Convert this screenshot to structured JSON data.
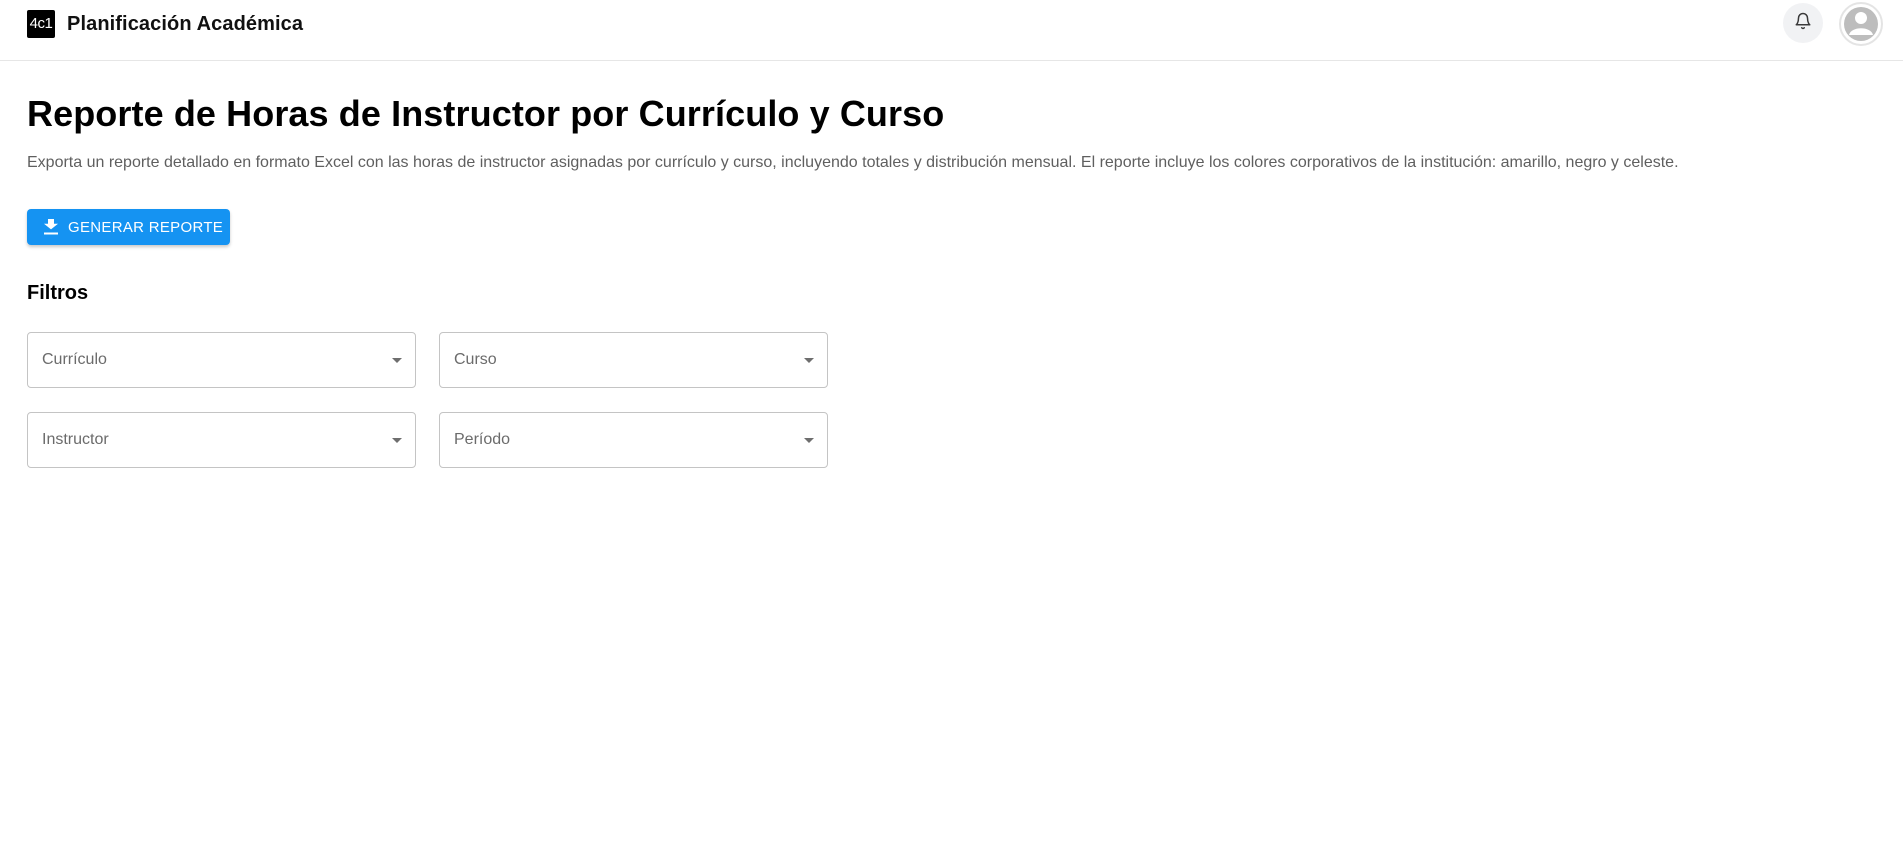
{
  "header": {
    "logo_text": "4c1",
    "app_title": "Planificación Académica",
    "icons": {
      "notifications": "bell-icon",
      "profile": "account-circle-icon"
    }
  },
  "main": {
    "title": "Reporte de Horas de Instructor por Currículo y Curso",
    "description": "Exporta un reporte detallado en formato Excel con las horas de instructor asignadas por currículo y curso, incluyendo totales y distribución mensual. El reporte incluye los colores corporativos de la institución: amarillo, negro y celeste.",
    "generate_button": {
      "label": "GENERAR REPORTE",
      "icon": "download-icon"
    },
    "filters": {
      "title": "Filtros",
      "fields": [
        {
          "label": "Currículo",
          "value": ""
        },
        {
          "label": "Curso",
          "value": ""
        },
        {
          "label": "Instructor",
          "value": ""
        },
        {
          "label": "Período",
          "value": ""
        }
      ]
    }
  },
  "colors": {
    "primary": "#1593f2",
    "logo_bg": "#000000",
    "border": "#c4c4c4",
    "muted_text": "#5f5f5f"
  }
}
